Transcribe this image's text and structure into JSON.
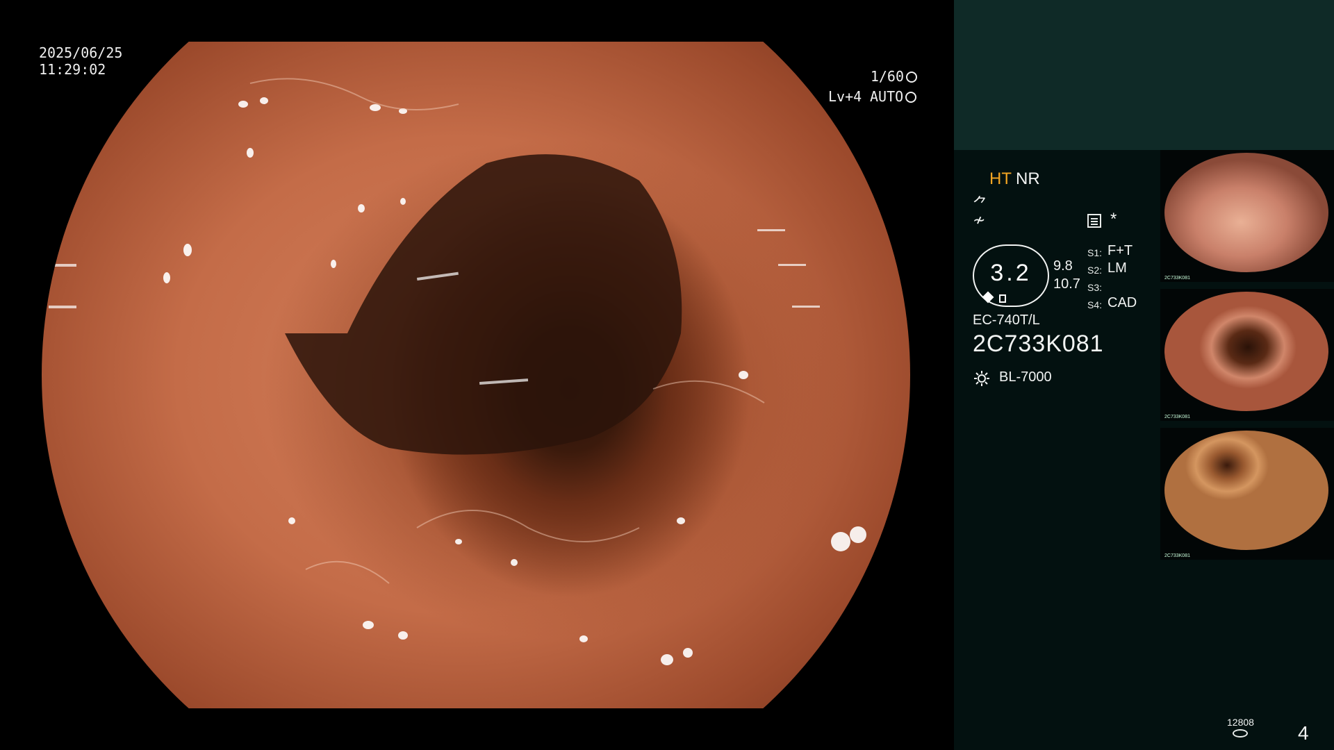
{
  "overlay": {
    "date": "2025/06/25",
    "time": "11:29:02",
    "shutter": "1/60",
    "level": "Lv+4",
    "mode": "AUTO"
  },
  "panel": {
    "ht_label": "HT",
    "nr_label": "NR",
    "icon_a": "⺈",
    "icon_b": "≁",
    "star": "*",
    "gauge_value": "3.2",
    "value_top": "9.8",
    "value_bottom": "10.7",
    "switches": [
      {
        "key": "S1:",
        "value": "F+T"
      },
      {
        "key": "S2:",
        "value": "LM"
      },
      {
        "key": "S3:",
        "value": ""
      },
      {
        "key": "S4:",
        "value": "CAD"
      }
    ],
    "scope_model": "EC-740T/L",
    "scope_serial": "2C733K081",
    "light_source": "BL-7000",
    "image_count": "12808",
    "page_number": "4"
  },
  "thumbnails": [
    {
      "caption": "2C733K081"
    },
    {
      "caption": "2C733K081"
    },
    {
      "caption": "2C733K081"
    }
  ],
  "colors": {
    "ht_accent": "#f5a623",
    "panel_bg": "#031110",
    "panel_top_bg": "#0f2a27"
  }
}
